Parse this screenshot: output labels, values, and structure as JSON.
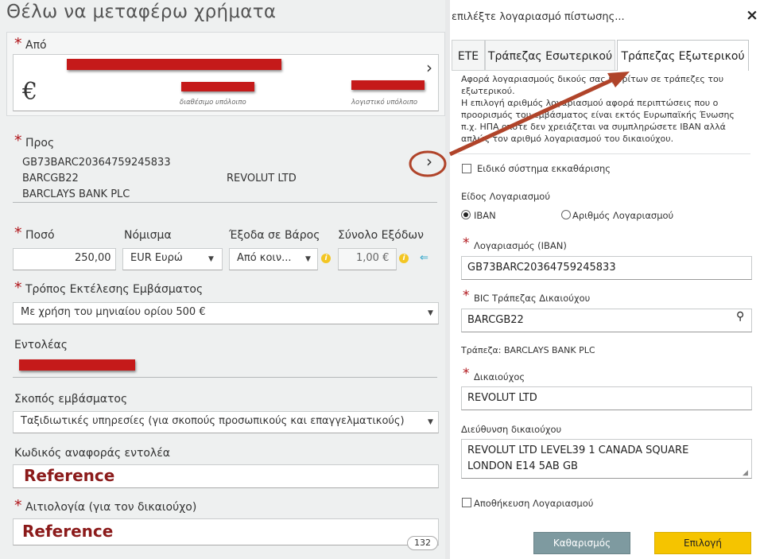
{
  "page_title": "Θέλω να μεταφέρω χρήματα",
  "from": {
    "label": "Από",
    "currency_symbol": "€",
    "available_balance_label": "διαθέσιμο υπόλοιπο",
    "ledger_balance_label": "λογιστικό υπόλοιπο"
  },
  "to": {
    "label": "Προς",
    "iban": "GB73BARC20364759245833",
    "bic": "BARCGB22",
    "beneficiary": "REVOLUT LTD",
    "bank": "BARCLAYS BANK PLC"
  },
  "amount": {
    "label": "Ποσό",
    "value": "250,00",
    "currency_label": "Νόμισμα",
    "currency_value": "EUR Ευρώ",
    "charges_label": "Έξοδα σε Βάρος",
    "charges_value": "Από κοιν...",
    "total_label": "Σύνολο Εξόδων",
    "total_value": "1,00 €"
  },
  "execution": {
    "label": "Τρόπος Εκτέλεσης Εμβάσματος",
    "value": "Με χρήση του μηνιαίου ορίου 500 €"
  },
  "orderer": {
    "label": "Εντολέας"
  },
  "purpose": {
    "label": "Σκοπός εμβάσματος",
    "value": "Ταξιδιωτικές υπηρεσίες (για σκοπούς προσωπικούς και επαγγελματικούς)"
  },
  "reference": {
    "label": "Κωδικός αναφοράς εντολέα",
    "value": "Reference"
  },
  "reason": {
    "label": "Αιτιολογία (για τον δικαιούχο)",
    "value": "Reference",
    "counter": "132"
  },
  "dialog": {
    "title": "επιλέξτε λογαριασμό πίστωσης...",
    "close": "×",
    "tabs": [
      "ΕΤΕ",
      "Τράπεζας Εσωτερικού",
      "Τράπεζας Εξωτερικού"
    ],
    "active_tab": 2,
    "description": "Αφορά λογαριασμούς δικούς σας ή τρίτων σε τράπεζες του εξωτερικού.\nΗ επιλογή αριθμός λογαριασμού αφορά περιπτώσεις που ο προορισμός του εμβάσματος είναι εκτός Ευρωπαϊκής Ένωσης π.χ. ΗΠΑ οπότε δεν χρειάζεται να συμπληρώσετε IBAN αλλά απλώς τον αριθμό λογαριασμού του δικαιούχου.",
    "special_clearing": "Ειδικό σύστημα εκκαθάρισης",
    "account_type_label": "Είδος Λογαριασμού",
    "iban_option": "IBAN",
    "account_number_option": "Αριθμός Λογαριασμού",
    "account_label": "Λογαριασμός (IBAN)",
    "account_value": "GB73BARC20364759245833",
    "bic_label": "BIC Τράπεζας Δικαιούχου",
    "bic_value": "BARCGB22",
    "bank_line": "Τράπεζα: BARCLAYS BANK PLC",
    "beneficiary_label": "Δικαιούχος",
    "beneficiary_value": "REVOLUT LTD",
    "address_label": "Διεύθυνση δικαιούχου",
    "address_line1": "REVOLUT LTD LEVEL39 1 CANADA SQUARE",
    "address_line2": "LONDON E14 5AB GB",
    "save_account": "Αποθήκευση Λογαριασμού",
    "clear_button": "Καθαρισμός",
    "select_button": "Επιλογή"
  },
  "colors": {
    "required_star": "#b0151a",
    "redaction": "#c51a1a",
    "select_button": "#f5c400",
    "clear_button": "#7e9aa0",
    "annotation": "#b0442a"
  }
}
